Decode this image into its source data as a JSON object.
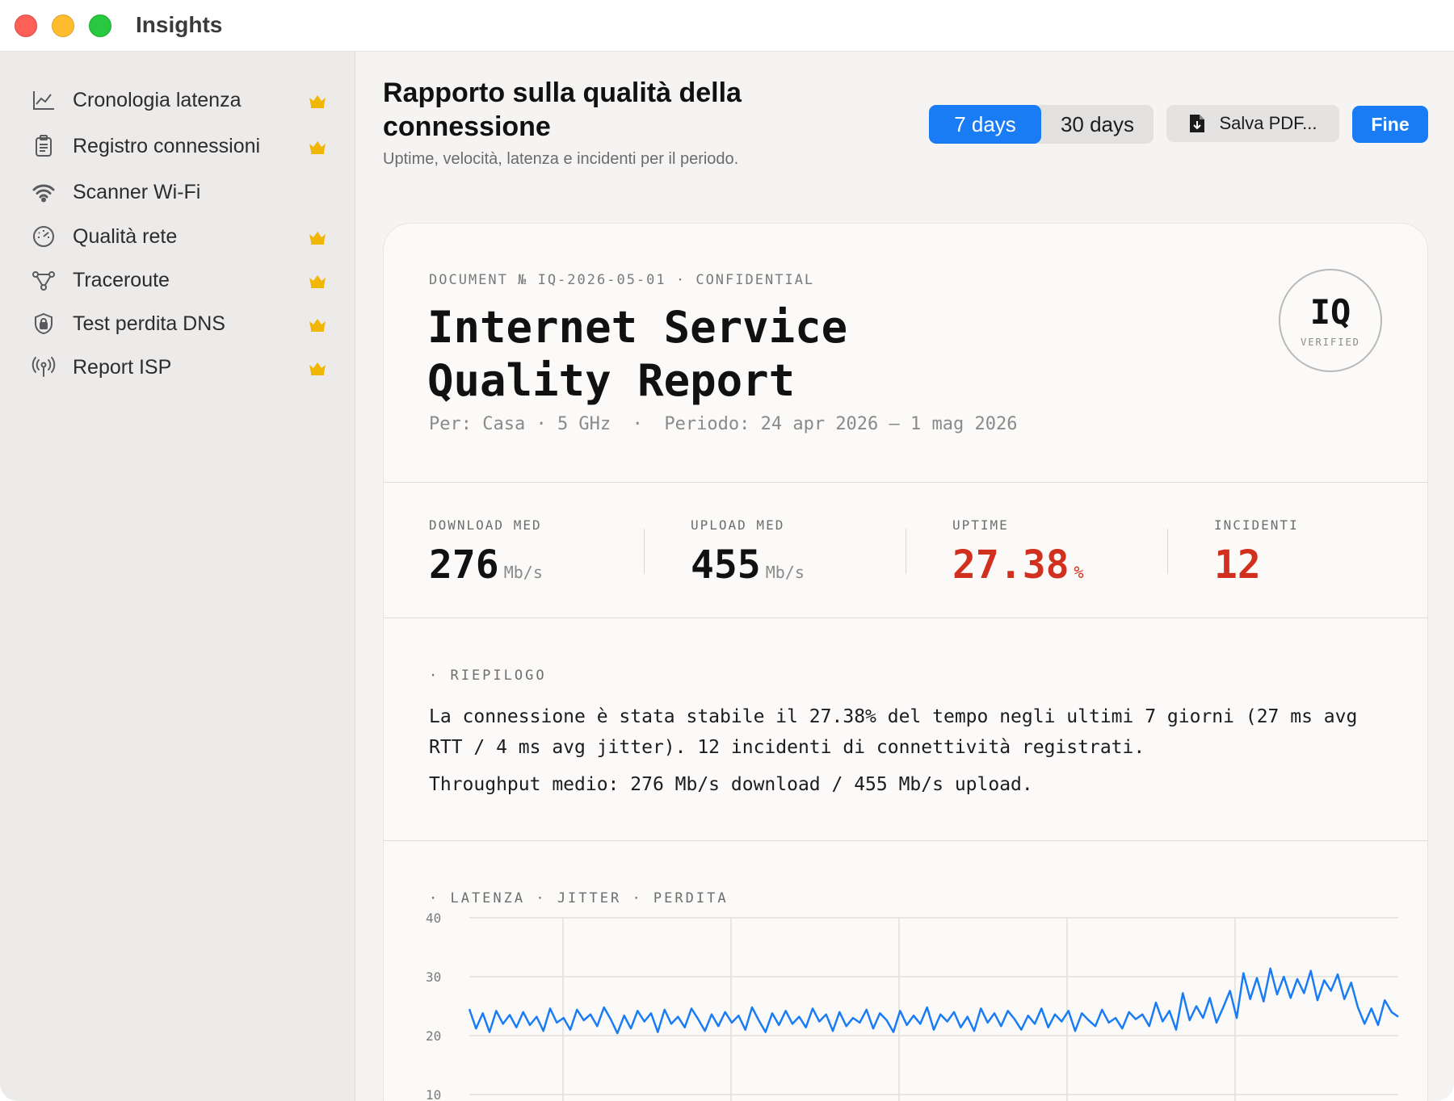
{
  "window": {
    "title": "Insights"
  },
  "sidebar": {
    "items": [
      {
        "label": "Cronologia latenza",
        "icon": "chart-line-icon",
        "premium": true
      },
      {
        "label": "Registro connessioni",
        "icon": "clipboard-icon",
        "premium": true
      },
      {
        "label": "Scanner Wi-Fi",
        "icon": "wifi-icon",
        "premium": false
      },
      {
        "label": "Qualità rete",
        "icon": "gauge-icon",
        "premium": true
      },
      {
        "label": "Traceroute",
        "icon": "route-nodes-icon",
        "premium": true
      },
      {
        "label": "Test perdita DNS",
        "icon": "shield-lock-icon",
        "premium": true
      },
      {
        "label": "Report ISP",
        "icon": "antenna-icon",
        "premium": true
      }
    ]
  },
  "header": {
    "title": "Rapporto sulla qualità della connessione",
    "subtitle": "Uptime, velocità, latenza e incidenti per il periodo.",
    "range_options": [
      "7 days",
      "30 days"
    ],
    "range_selected": "7 days",
    "save_pdf_label": "Salva PDF...",
    "done_label": "Fine"
  },
  "report": {
    "meta": "DOCUMENT № IQ-2026-05-01 · CONFIDENTIAL",
    "title_line1": "Internet Service",
    "title_line2": "Quality Report",
    "per_line": "Per: Casa · 5 GHz  ·  Periodo: 24 apr 2026 — 1 mag 2026",
    "stamp": {
      "main": "IQ",
      "sub": "VERIFIED"
    },
    "stats": [
      {
        "label": "DOWNLOAD MED",
        "value": "276",
        "unit": "Mb/s",
        "alert": false
      },
      {
        "label": "UPLOAD MED",
        "value": "455",
        "unit": "Mb/s",
        "alert": false
      },
      {
        "label": "UPTIME",
        "value": "27.38",
        "unit": "%",
        "alert": true
      },
      {
        "label": "INCIDENTI",
        "value": "12",
        "unit": "",
        "alert": true
      }
    ],
    "summary_label": "· RIEPILOGO",
    "summary_p1": "La connessione è stata stabile il 27.38% del tempo negli ultimi 7 giorni (27 ms avg RTT / 4 ms avg jitter). 12 incidenti di connettività registrati.",
    "summary_p2": "Throughput medio: 276 Mb/s download / 455 Mb/s upload.",
    "chart_label": "· LATENZA · JITTER · PERDITA"
  },
  "colors": {
    "accent": "#1a7cf5",
    "alert": "#d1301f",
    "crown": "#f2b705"
  },
  "chart_data": {
    "type": "line",
    "title": "",
    "xlabel": "",
    "ylabel": "",
    "ylim": [
      10,
      40
    ],
    "yticks": [
      "40",
      "30",
      "20",
      "10"
    ],
    "series": [
      {
        "color": "#1a7cf5",
        "values": [
          24.5,
          21.2,
          23.8,
          20.6,
          24.2,
          22.0,
          23.5,
          21.4,
          24.0,
          21.8,
          23.2,
          20.8,
          24.6,
          22.2,
          23.0,
          21.0,
          24.4,
          22.6,
          23.6,
          21.6,
          24.8,
          22.8,
          20.4,
          23.4,
          21.2,
          24.2,
          22.4,
          23.8,
          20.6,
          24.4,
          22.0,
          23.2,
          21.4,
          24.6,
          22.8,
          20.8,
          23.6,
          21.6,
          24.0,
          22.2,
          23.4,
          21.0,
          24.8,
          22.6,
          20.6,
          23.8,
          21.8,
          24.2,
          22.0,
          23.2,
          21.4,
          24.6,
          22.4,
          23.6,
          20.8,
          24.0,
          21.6,
          23.0,
          22.2,
          24.4,
          21.2,
          23.8,
          22.6,
          20.6,
          24.2,
          21.8,
          23.4,
          22.0,
          24.8,
          21.0,
          23.6,
          22.4,
          24.0,
          21.4,
          23.2,
          20.8,
          24.6,
          22.2,
          23.8,
          21.6,
          24.2,
          22.8,
          21.0,
          23.4,
          22.0,
          24.6,
          21.4,
          23.6,
          22.4,
          24.2,
          20.8,
          23.8,
          22.6,
          21.6,
          24.4,
          22.2,
          23.0,
          21.2,
          24.0,
          22.8,
          23.6,
          21.6,
          25.6,
          22.4,
          24.2,
          21.0,
          27.2,
          22.6,
          25.0,
          23.0,
          26.4,
          22.2,
          24.8,
          27.6,
          23.0,
          30.6,
          26.2,
          29.8,
          25.8,
          31.4,
          27.0,
          30.0,
          26.4,
          29.6,
          27.2,
          31.0,
          26.0,
          29.4,
          27.6,
          30.4,
          26.2,
          29.0,
          24.8,
          22.0,
          24.6,
          21.8,
          26.0,
          24.0,
          23.2
        ],
        "x_ticks_count": 0
      }
    ],
    "grid": true,
    "legend": "none"
  }
}
